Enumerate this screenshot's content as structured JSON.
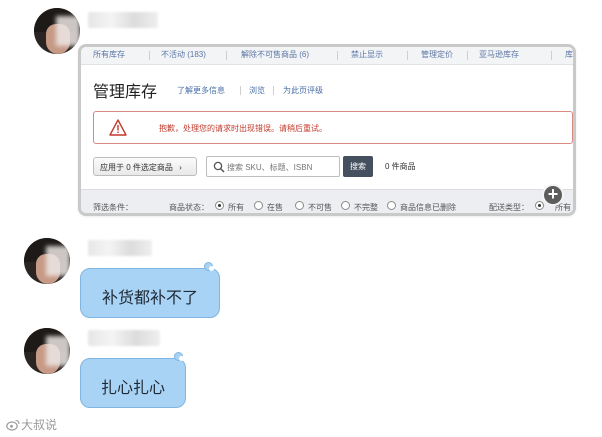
{
  "seller_page": {
    "tabs": [
      "所有库存",
      "不活动 (183)",
      "解除不可售商品 (6)",
      "禁止显示",
      "管理定价",
      "亚马逊库存",
      "库"
    ],
    "title": "管理库存",
    "title_links": [
      "了解更多信息",
      "浏览",
      "为此页评级"
    ],
    "alert_message": "抱歉，处理您的请求时出现错误。请稍后重试。",
    "apply_button": "应用于 0 件选定商品",
    "search_placeholder": "搜索 SKU、标题、ISBN",
    "search_button": "搜索",
    "item_count": "0 件商品",
    "filter_label": "筛选条件：",
    "status_label": "商品状态：",
    "status_options": [
      "所有",
      "在售",
      "不可售",
      "不完整",
      "商品信息已删除"
    ],
    "status_selected": "所有",
    "fulfillment_label": "配送类型：",
    "fulfillment_option": "所有"
  },
  "chat": {
    "messages": [
      "补货都补不了",
      "扎心扎心"
    ]
  },
  "watermark": "大叔说",
  "colors": {
    "bubble": "#a9d3f5",
    "alert_border": "#d88a80",
    "alert_text": "#c23a2b",
    "search_button": "#44505e",
    "link": "#4a6fa8"
  }
}
